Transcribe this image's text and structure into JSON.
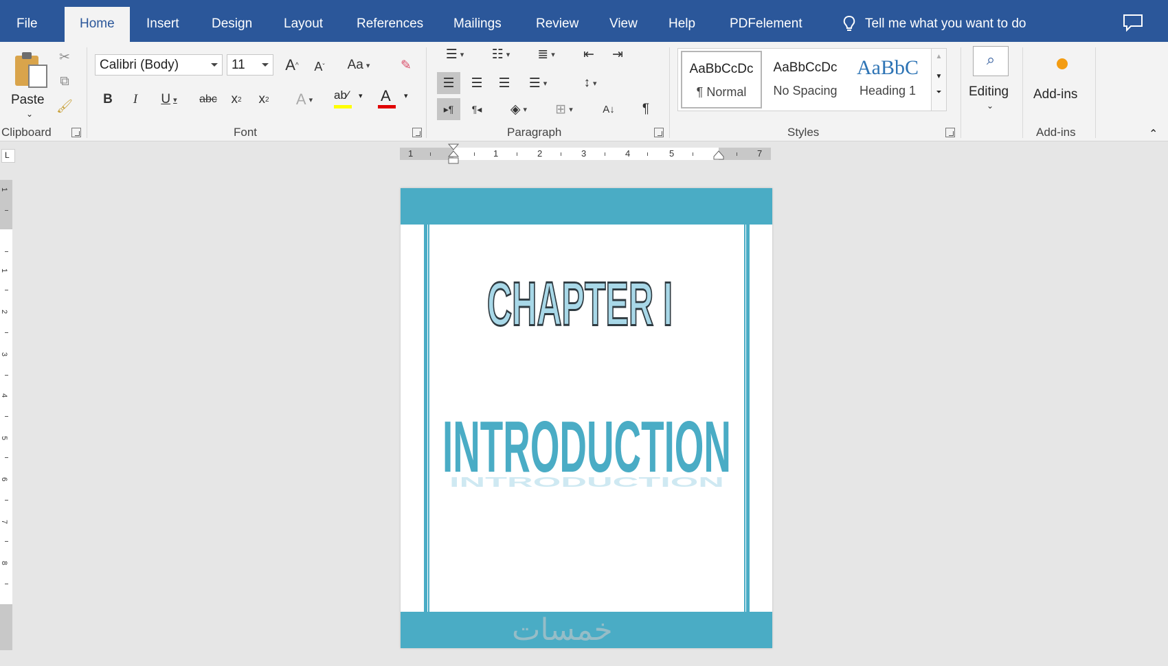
{
  "tabs": [
    {
      "label": "File",
      "active": false
    },
    {
      "label": "Home",
      "active": true
    },
    {
      "label": "Insert",
      "active": false
    },
    {
      "label": "Design",
      "active": false
    },
    {
      "label": "Layout",
      "active": false
    },
    {
      "label": "References",
      "active": false
    },
    {
      "label": "Mailings",
      "active": false
    },
    {
      "label": "Review",
      "active": false
    },
    {
      "label": "View",
      "active": false
    },
    {
      "label": "Help",
      "active": false
    },
    {
      "label": "PDFelement",
      "active": false
    }
  ],
  "tell_me": "Tell me what you want to do",
  "ribbon": {
    "clipboard": {
      "paste_label": "Paste",
      "group_label": "Clipboard"
    },
    "font": {
      "font_name": "Calibri (Body)",
      "font_size": "11",
      "group_label": "Font",
      "case_label": "Aa"
    },
    "paragraph": {
      "group_label": "Paragraph"
    },
    "styles": {
      "group_label": "Styles",
      "items": [
        {
          "preview": "AaBbCcDc",
          "name": "¶ Normal"
        },
        {
          "preview": "AaBbCcDc",
          "name": "No Spacing"
        },
        {
          "preview": "AaBbC",
          "name": "Heading 1"
        }
      ]
    },
    "editing": {
      "label": "Editing"
    },
    "addins": {
      "label": "Add-ins",
      "group_label": "Add-ins"
    }
  },
  "ruler": {
    "h_numbers": [
      "1",
      "1",
      "2",
      "3",
      "4",
      "5",
      "7"
    ],
    "v_numbers": [
      "1",
      "1",
      "2",
      "3",
      "4",
      "5",
      "6",
      "7",
      "8"
    ]
  },
  "document": {
    "wordart_title": "CHAPTER I",
    "wordart_subtitle": "INTRODUCTION",
    "accent_color": "#4aacc5",
    "title_fill": "#a8d8e8"
  },
  "watermark": "خمسات",
  "colors": {
    "tab_bar": "#2b579a",
    "ribbon": "#f3f3f3",
    "highlight": "#ffff00",
    "font_color": "#e00000"
  }
}
